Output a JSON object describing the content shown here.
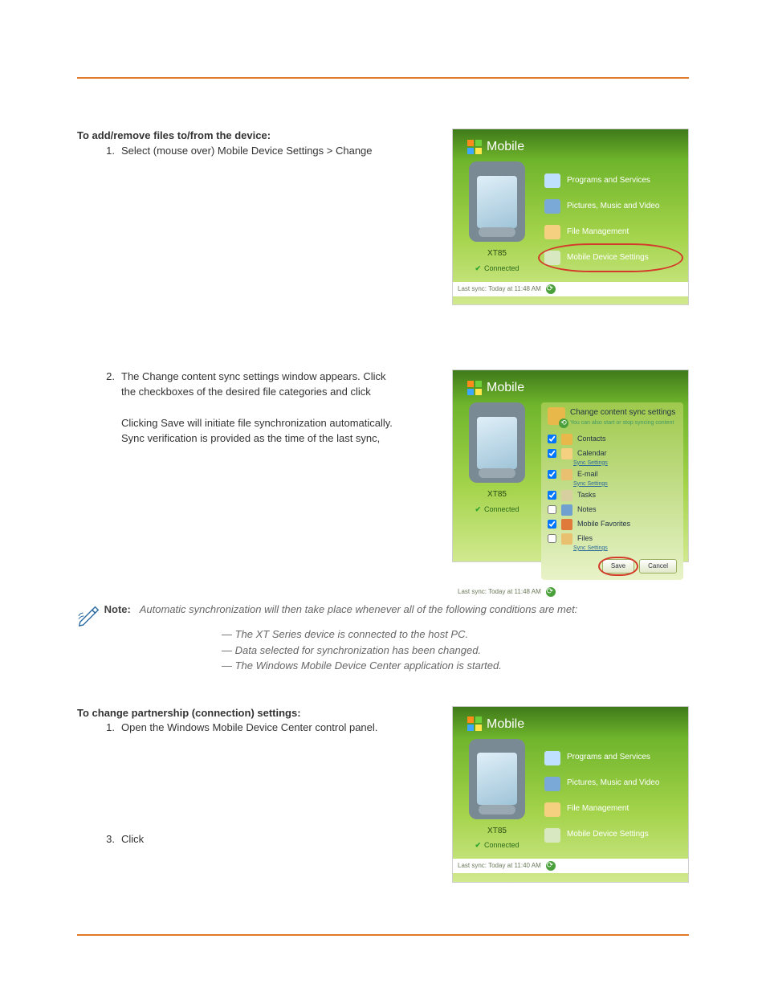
{
  "section1": {
    "heading": "To add/remove files to/from the device:",
    "step1_num": "1.",
    "step1_text": "Select (mouse over) Mobile Device Settings > Change",
    "step2_num": "2.",
    "step2_text_a": "The Change content sync settings window appears.  Click",
    "step2_text_b": "the checkboxes of the desired file categories and click",
    "step2_para2_a": "Clicking Save will initiate file synchronization automatically.",
    "step2_para2_b": "Sync verification is provided as the time of the last sync,"
  },
  "note": {
    "label": "Note:",
    "lead": "Automatic synchronization will then take place whenever all of the following conditions are met:",
    "bullets": [
      "—  The XT Series device is connected to the host PC.",
      "—  Data selected for synchronization has been changed.",
      "—  The Windows Mobile Device Center application is started."
    ]
  },
  "section2": {
    "heading": "To change partnership (connection) settings:",
    "step1_num": "1.",
    "step1_text": "Open the Windows Mobile Device Center control panel.",
    "step3_num": "3.",
    "step3_text": "Click"
  },
  "wm": {
    "brand": "Mobile",
    "device": "XT85",
    "connected": "Connected",
    "status": "Last sync: Today at 11:48 AM",
    "status2": "Last sync: Today at 11:48 AM",
    "status3": "Last sync: Today at 11:40 AM",
    "menu": {
      "programs": "Programs and Services",
      "pictures": "Pictures, Music and Video",
      "filemgmt": "File Management",
      "devset": "Mobile Device Settings"
    },
    "settings": {
      "title": "Change content sync settings",
      "sub": "You can also start or stop syncing content",
      "contacts": "Contacts",
      "calendar": "Calendar",
      "syncsettings": "Sync Settings",
      "email": "E-mail",
      "tasks": "Tasks",
      "notes": "Notes",
      "favorites": "Mobile Favorites",
      "files": "Files",
      "save": "Save",
      "cancel": "Cancel"
    }
  }
}
